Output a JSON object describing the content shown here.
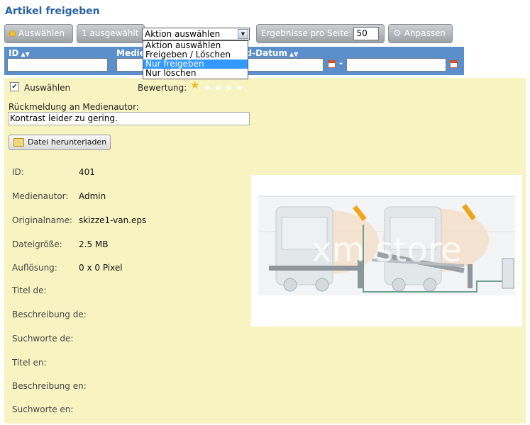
{
  "page": {
    "title": "Artikel freigeben"
  },
  "toolbar": {
    "select_label": "Auswählen",
    "selected_count": "1 ausgewählt",
    "action_value": "Aktion auswählen",
    "action_options": [
      "Aktion auswählen",
      "Freigeben / Löschen",
      "Nur freigeben",
      "Nur löschen"
    ],
    "action_highlighted": "Nur freigeben",
    "results_label": "Ergebnisse pro Seite:",
    "results_value": "50",
    "customize_label": "Anpassen"
  },
  "columns": {
    "id": "ID",
    "media": "Medie",
    "date": "nd-Datum",
    "date_separator": "-"
  },
  "item": {
    "select_label": "Auswählen",
    "selected": true,
    "rating_label": "Bewertung:",
    "rating": 1,
    "rating_max": 5,
    "feedback_label": "Rückmeldung an Medienautor:",
    "feedback_value": "Kontrast leider zu gering.",
    "download_label": "Datei herunterladen",
    "fields": [
      {
        "label": "ID:",
        "value": "401"
      },
      {
        "label": "Medienautor:",
        "value": "Admin"
      },
      {
        "label": "Originalname:",
        "value": "skizze1-van.eps"
      },
      {
        "label": "Dateigröße:",
        "value": "2.5 MB"
      },
      {
        "label": "Auflösung:",
        "value": "0 x 0 Pixel"
      },
      {
        "label": "Titel de:",
        "value": ""
      },
      {
        "label": "Beschreibung de:",
        "value": ""
      },
      {
        "label": "Suchworte de:",
        "value": ""
      },
      {
        "label": "Titel en:",
        "value": ""
      },
      {
        "label": "Beschreibung en:",
        "value": ""
      },
      {
        "label": "Suchworte en:",
        "value": ""
      }
    ],
    "watermark": "xm store"
  },
  "colors": {
    "title": "#2a63a8",
    "header_bar": "#5a8fcc",
    "panel": "#f8f4c2",
    "highlight": "#3399ff",
    "star": "#f3b61f"
  }
}
